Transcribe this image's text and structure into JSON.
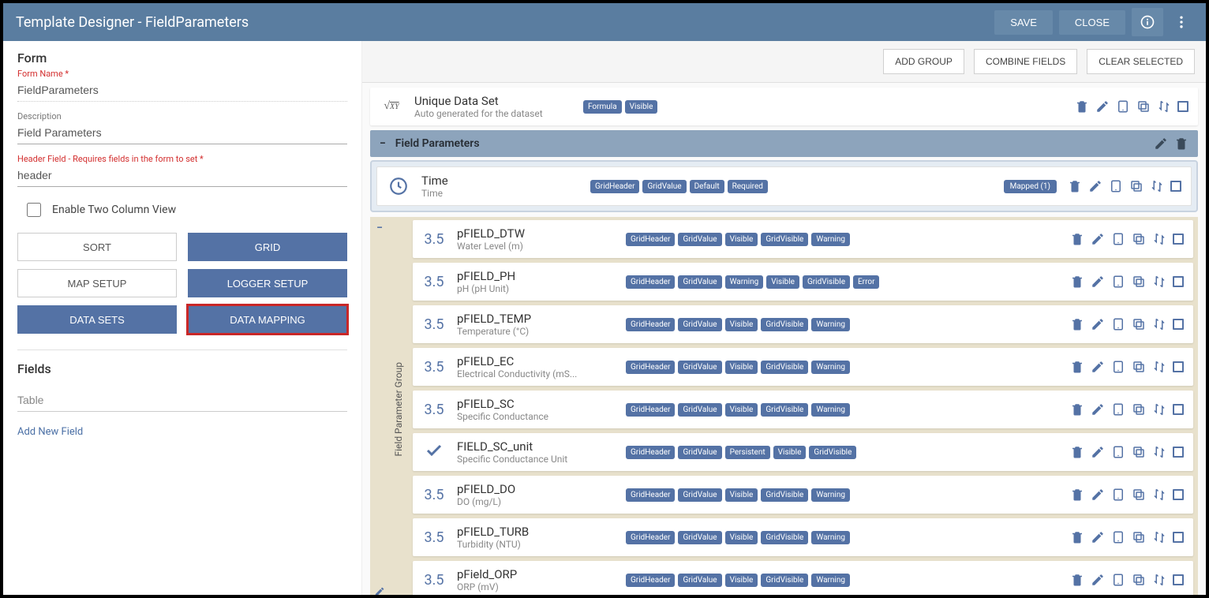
{
  "header": {
    "title": "Template Designer - FieldParameters",
    "save": "SAVE",
    "close": "CLOSE"
  },
  "form": {
    "heading": "Form",
    "name_label": "Form Name *",
    "name_value": "FieldParameters",
    "desc_label": "Description",
    "desc_value": "Field Parameters",
    "header_label": "Header Field - Requires fields in the form to set *",
    "header_value": "header",
    "two_col": "Enable Two Column View"
  },
  "buttons": {
    "sort": "SORT",
    "grid": "GRID",
    "mapsetup": "MAP SETUP",
    "loggersetup": "LOGGER SETUP",
    "datasets": "DATA SETS",
    "datamapping": "DATA MAPPING"
  },
  "fields": {
    "heading": "Fields",
    "table": "Table",
    "add": "Add New Field"
  },
  "top": {
    "addgroup": "ADD GROUP",
    "combine": "COMBINE FIELDS",
    "clear": "CLEAR SELECTED"
  },
  "unique": {
    "name": "Unique Data Set",
    "sub": "Auto generated for the dataset",
    "tags": [
      "Formula",
      "Visible"
    ]
  },
  "group_header": "Field Parameters",
  "time_row": {
    "name": "Time",
    "sub": "Time",
    "tags": [
      "GridHeader",
      "GridValue",
      "Default",
      "Required"
    ],
    "mapped": "Mapped  (1)"
  },
  "group_label": "Field Parameter Group",
  "rows": [
    {
      "icon": "num",
      "name": "pFIELD_DTW",
      "sub": "Water Level (m)",
      "tags": [
        "GridHeader",
        "GridValue",
        "Visible",
        "GridVisible",
        "Warning"
      ]
    },
    {
      "icon": "num",
      "name": "pFIELD_PH",
      "sub": "pH (pH Unit)",
      "tags": [
        "GridHeader",
        "GridValue",
        "Warning",
        "Visible",
        "GridVisible",
        "Error"
      ]
    },
    {
      "icon": "num",
      "name": "pFIELD_TEMP",
      "sub": "Temperature (°C)",
      "tags": [
        "GridHeader",
        "GridValue",
        "Visible",
        "GridVisible",
        "Warning"
      ]
    },
    {
      "icon": "num",
      "name": "pFIELD_EC",
      "sub": "Electrical Conductivity (mS...",
      "tags": [
        "GridHeader",
        "GridValue",
        "Visible",
        "GridVisible",
        "Warning"
      ]
    },
    {
      "icon": "num",
      "name": "pFIELD_SC",
      "sub": "Specific Conductance",
      "tags": [
        "GridHeader",
        "GridValue",
        "Visible",
        "GridVisible",
        "Warning"
      ]
    },
    {
      "icon": "check",
      "name": "FIELD_SC_unit",
      "sub": "Specific Conductance Unit",
      "tags": [
        "GridHeader",
        "GridValue",
        "Persistent",
        "Visible",
        "GridVisible"
      ]
    },
    {
      "icon": "num",
      "name": "pFIELD_DO",
      "sub": "DO (mg/L)",
      "tags": [
        "GridHeader",
        "GridValue",
        "Visible",
        "GridVisible",
        "Warning"
      ]
    },
    {
      "icon": "num",
      "name": "pFIELD_TURB",
      "sub": "Turbidity (NTU)",
      "tags": [
        "GridHeader",
        "GridValue",
        "Visible",
        "GridVisible",
        "Warning"
      ]
    },
    {
      "icon": "num",
      "name": "pField_ORP",
      "sub": "ORP (mV)",
      "tags": [
        "GridHeader",
        "GridValue",
        "Visible",
        "GridVisible",
        "Warning"
      ]
    }
  ],
  "num_icon_text": "3.5"
}
